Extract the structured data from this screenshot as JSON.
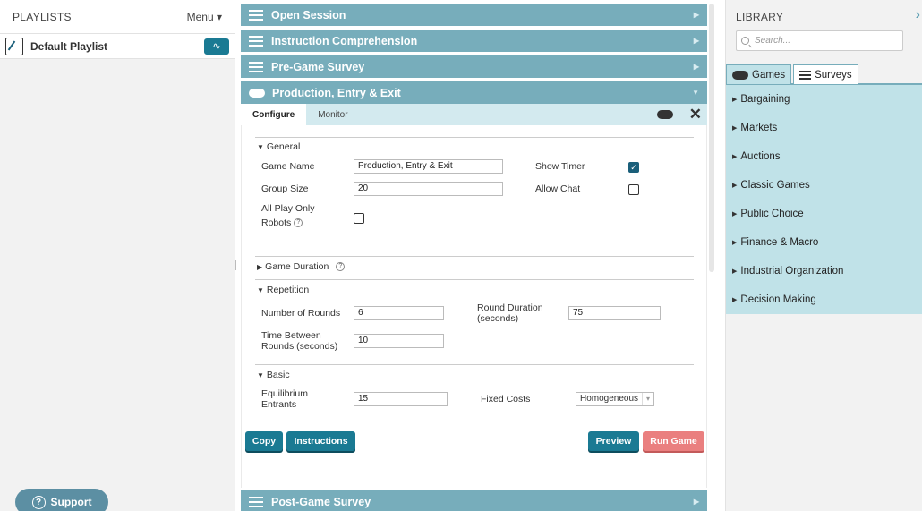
{
  "left": {
    "title": "PLAYLISTS",
    "menu_label": "Menu ▾",
    "playlist_name": "Default Playlist",
    "support_label": "Support"
  },
  "accordion": {
    "open_session": "Open Session",
    "instruction": "Instruction Comprehension",
    "pregame": "Pre-Game Survey",
    "production": "Production, Entry & Exit",
    "postgame": "Post-Game Survey"
  },
  "tabs": {
    "configure": "Configure",
    "monitor": "Monitor"
  },
  "general": {
    "title": "General",
    "game_name_label": "Game Name",
    "game_name_value": "Production, Entry & Exit",
    "group_size_label": "Group Size",
    "group_size_value": "20",
    "all_play_label_1": "All Play Only",
    "all_play_label_2": "Robots",
    "show_timer_label": "Show Timer",
    "allow_chat_label": "Allow Chat",
    "show_timer_checked": true,
    "allow_chat_checked": false,
    "all_play_checked": false
  },
  "duration": {
    "title": "Game Duration"
  },
  "repetition": {
    "title": "Repetition",
    "rounds_label": "Number of Rounds",
    "rounds_value": "6",
    "round_duration_label_1": "Round Duration",
    "round_duration_label_2": "(seconds)",
    "round_duration_value": "75",
    "time_between_label_1": "Time Between",
    "time_between_label_2": "Rounds (seconds)",
    "time_between_value": "10"
  },
  "basic": {
    "title": "Basic",
    "eq_label_1": "Equilibrium",
    "eq_label_2": "Entrants",
    "eq_value": "15",
    "fixed_costs_label": "Fixed Costs",
    "fixed_costs_value": "Homogeneous"
  },
  "buttons": {
    "copy": "Copy",
    "instructions": "Instructions",
    "preview": "Preview",
    "run_game": "Run Game"
  },
  "library": {
    "title": "LIBRARY",
    "search_placeholder": "Search...",
    "tab_games": "Games",
    "tab_surveys": "Surveys",
    "items": [
      "Bargaining",
      "Markets",
      "Auctions",
      "Classic Games",
      "Public Choice",
      "Finance & Macro",
      "Industrial Organization",
      "Decision Making"
    ]
  }
}
